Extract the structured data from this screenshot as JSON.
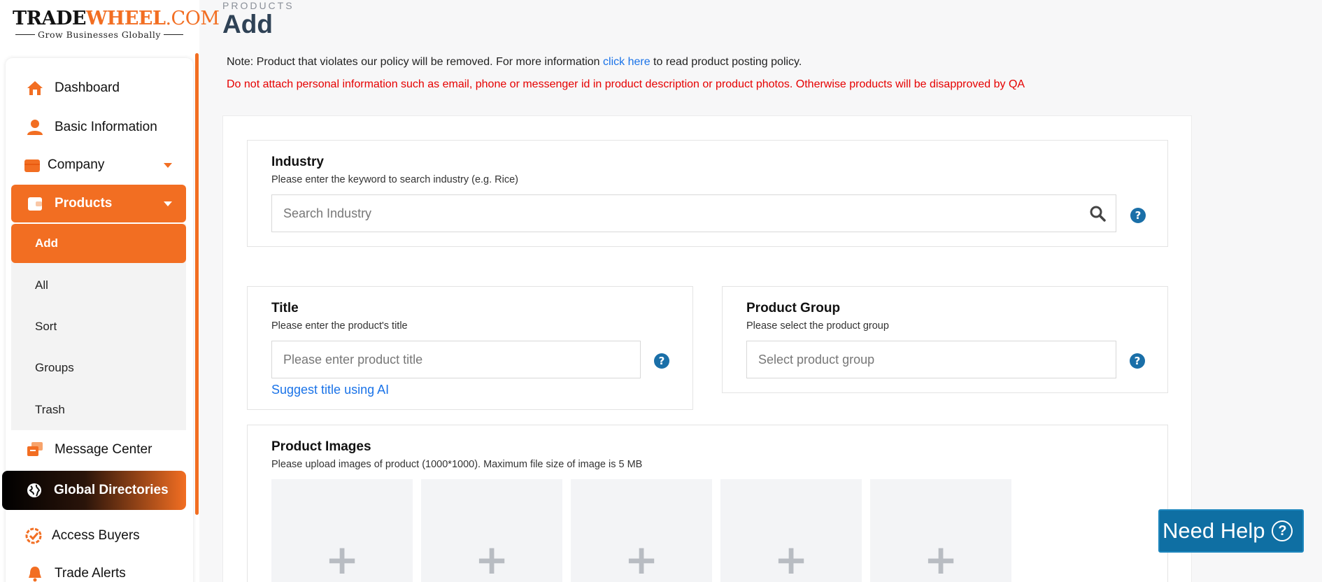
{
  "logo": {
    "trade": "TRADE",
    "wheel": "WHEEL",
    "com": ".COM",
    "tagline": "Grow Businesses Globally"
  },
  "sidebar": {
    "items": [
      {
        "label": "Dashboard",
        "icon": "home-icon"
      },
      {
        "label": "Basic Information",
        "icon": "user-icon"
      },
      {
        "label": "Company",
        "icon": "briefcase-icon"
      },
      {
        "label": "Products",
        "icon": "wallet-icon"
      },
      {
        "label": "Message Center",
        "icon": "chat-icon"
      },
      {
        "label": "Global Directories",
        "icon": "globe-icon"
      },
      {
        "label": "Access Buyers",
        "icon": "badge-icon"
      },
      {
        "label": "Trade Alerts",
        "icon": "bell-icon"
      }
    ],
    "products_submenu": [
      "Add",
      "All",
      "Sort",
      "Groups",
      "Trash"
    ]
  },
  "header": {
    "breadcrumb": "PRODUCTS",
    "title": "Add"
  },
  "notice": {
    "note_prefix": "Note: Product that violates our policy will be removed. For more information ",
    "note_link": "click here",
    "note_suffix": " to read product posting policy.",
    "warning": "Do not attach personal information such as email, phone or messenger id in product description or product photos. Otherwise products will be disapproved by QA"
  },
  "form": {
    "industry": {
      "title": "Industry",
      "desc": "Please enter the keyword to search industry (e.g. Rice)",
      "placeholder": "Search Industry"
    },
    "title_field": {
      "title": "Title",
      "desc": "Please enter the product's title",
      "placeholder": "Please enter product title",
      "suggest": "Suggest title using AI"
    },
    "product_group": {
      "title": "Product Group",
      "desc": "Please select the product group",
      "placeholder": "Select product group"
    },
    "images": {
      "title": "Product Images",
      "desc": "Please upload images of product (1000*1000). Maximum file size of image is 5 MB",
      "slot_symbol": "+"
    },
    "help_symbol": "?"
  },
  "need_help": {
    "label": "Need Help",
    "symbol": "?"
  },
  "colors": {
    "brand_orange": "#f26e22",
    "title_navy": "#2f4256",
    "link_blue": "#1a73e8",
    "warning_red": "#e60000",
    "help_blue": "#0f6fa3"
  }
}
